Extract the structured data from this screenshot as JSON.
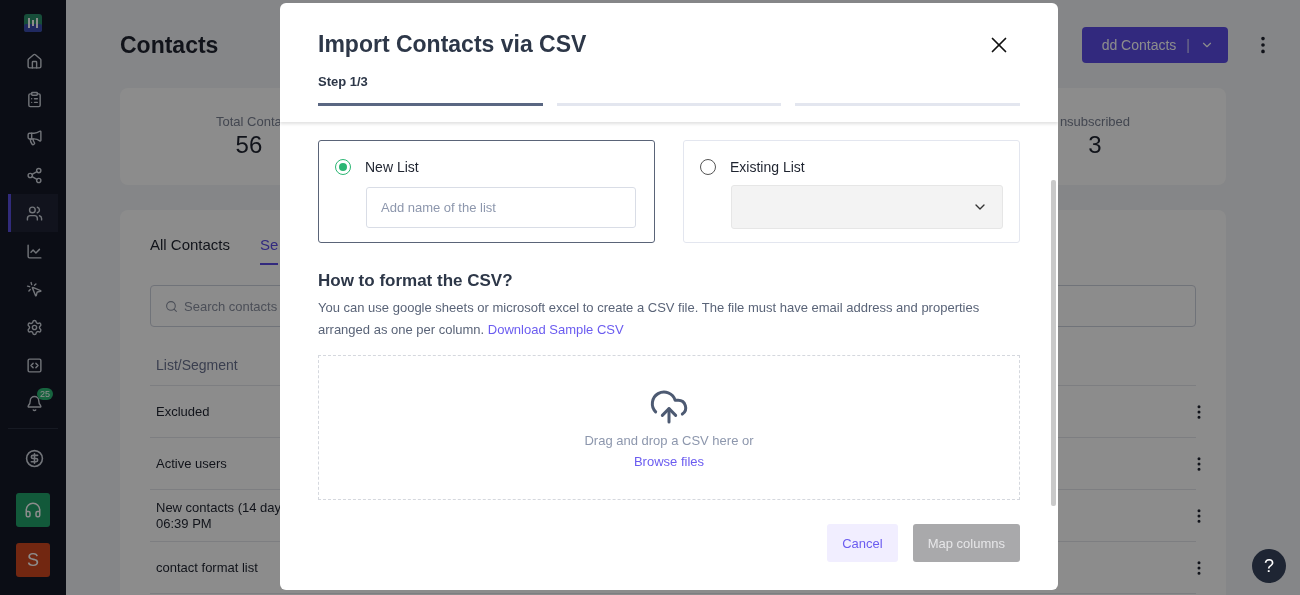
{
  "sidebar": {
    "items": [
      {
        "kind": "home",
        "selected": false
      },
      {
        "kind": "form",
        "selected": false
      },
      {
        "kind": "megaphone",
        "selected": false
      },
      {
        "kind": "flow",
        "selected": false
      },
      {
        "kind": "contacts",
        "selected": true
      },
      {
        "kind": "chart",
        "selected": false
      },
      {
        "kind": "click",
        "selected": false
      },
      {
        "kind": "settings",
        "selected": false
      },
      {
        "kind": "code",
        "selected": false
      },
      {
        "kind": "bell",
        "selected": false,
        "badge": "25"
      }
    ],
    "bottom_items": [
      {
        "kind": "billing"
      }
    ],
    "support": {
      "kind": "support"
    },
    "avatar": {
      "initial": "S"
    }
  },
  "page": {
    "title": "Contacts",
    "add_button": "dd Contacts",
    "add_separator": "|",
    "stats": [
      {
        "label": "Total Conta",
        "value": "56"
      },
      {
        "label": "nsubscribed",
        "value": "3"
      }
    ],
    "tabs": [
      {
        "label": "All Contacts",
        "selected": false
      },
      {
        "label": "Se",
        "selected": true
      }
    ],
    "search": {
      "placeholder": "Search contacts"
    },
    "table": {
      "columns": [
        "List/Segment"
      ],
      "rows": [
        {
          "lines": [
            "Excluded"
          ]
        },
        {
          "lines": [
            "Active users"
          ]
        },
        {
          "lines": [
            "New contacts (14 day",
            "06:39 PM"
          ]
        },
        {
          "lines": [
            "contact format list"
          ]
        }
      ]
    }
  },
  "dialog": {
    "title": "Import Contacts via CSV",
    "step": "Step 1/3",
    "steps": [
      {
        "selected": true
      },
      {
        "selected": false
      },
      {
        "selected": false
      }
    ],
    "options": [
      {
        "label": "New List",
        "selected": true,
        "kind": "input",
        "placeholder": "Add name of the list"
      },
      {
        "label": "Existing List",
        "selected": false,
        "kind": "select"
      }
    ],
    "format_heading": "How to format the CSV?",
    "format_text": "You can use google sheets or microsoft excel to create a CSV file. The file must have email address and properties arranged as one per column.",
    "format_link": "Download Sample CSV",
    "dropzone": {
      "text": "Drag and drop a CSV here or",
      "link": "Browse files"
    },
    "buttons": [
      {
        "label": "Cancel",
        "kind": "secondary",
        "disabled": false
      },
      {
        "label": "Map columns",
        "kind": "primary",
        "disabled": true
      }
    ]
  },
  "help": {
    "label": "?"
  }
}
